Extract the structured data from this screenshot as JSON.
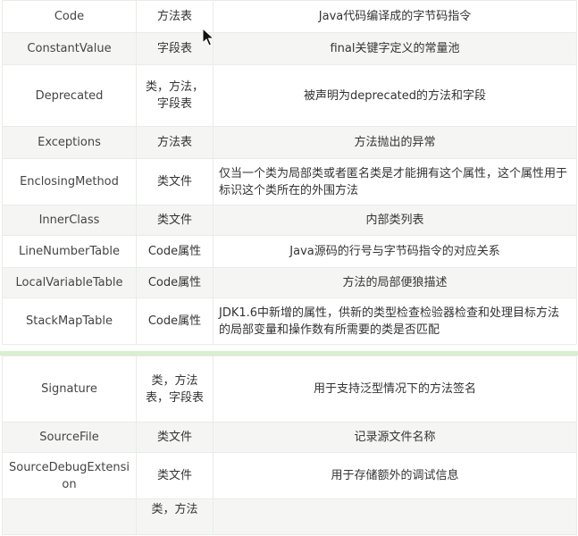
{
  "table_top": {
    "rows": [
      {
        "name": "Code",
        "type": "方法表",
        "desc": "Java代码编译成的字节码指令"
      },
      {
        "name": "ConstantValue",
        "type": "字段表",
        "desc": "final关键字定义的常量池"
      },
      {
        "name": "Deprecated",
        "type": "类，方法，字段表",
        "desc": "被声明为deprecated的方法和字段"
      },
      {
        "name": "Exceptions",
        "type": "方法表",
        "desc": "方法抛出的异常"
      },
      {
        "name": "EnclosingMethod",
        "type": "类文件",
        "desc": "仅当一个类为局部类或者匿名类是才能拥有这个属性，这个属性用于标识这个类所在的外围方法"
      },
      {
        "name": "InnerClass",
        "type": "类文件",
        "desc": "内部类列表"
      },
      {
        "name": "LineNumberTable",
        "type": "Code属性",
        "desc": "Java源码的行号与字节码指令的对应关系"
      },
      {
        "name": "LocalVariableTable",
        "type": "Code属性",
        "desc": "方法的局部便狼描述"
      },
      {
        "name": "StackMapTable",
        "type": "Code属性",
        "desc": "JDK1.6中新增的属性，供新的类型检查检验器检查和处理目标方法的局部变量和操作数有所需要的类是否匹配"
      }
    ]
  },
  "table_bottom": {
    "rows": [
      {
        "name": "Signature",
        "type": "类，方法表，字段表",
        "desc": "用于支持泛型情况下的方法签名"
      },
      {
        "name": "SourceFile",
        "type": "类文件",
        "desc": "记录源文件名称"
      },
      {
        "name": "SourceDebugExtension",
        "type": "类文件",
        "desc": "用于存储额外的调试信息"
      },
      {
        "name": "",
        "type": "类，方法",
        "desc": ""
      }
    ]
  }
}
